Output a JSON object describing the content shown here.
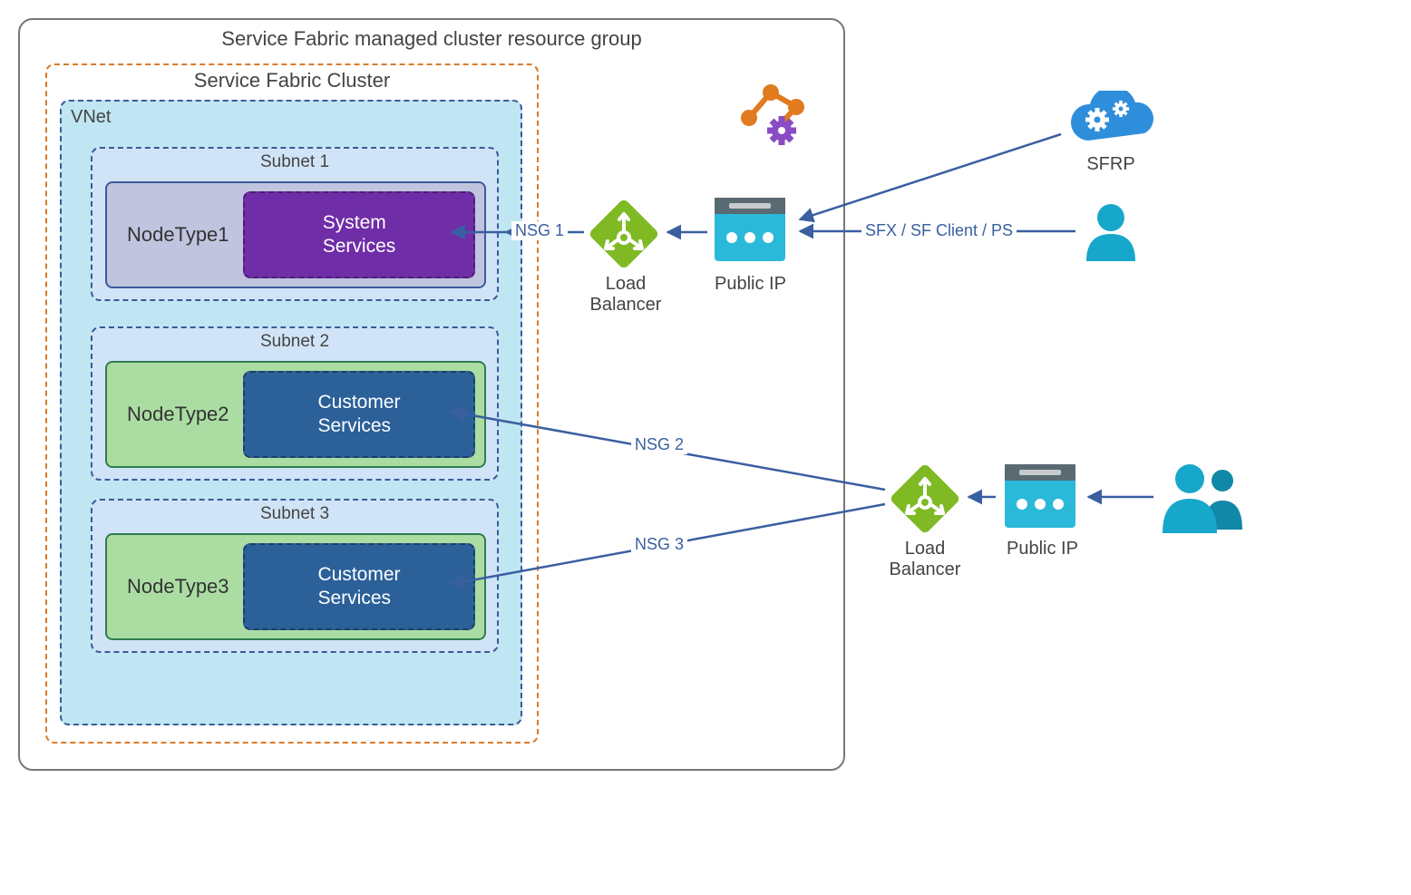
{
  "outer_title": "Service Fabric managed cluster resource group",
  "cluster_title": "Service Fabric Cluster",
  "vnet_label": "VNet",
  "subnets": {
    "s1": {
      "label": "Subnet 1",
      "nodetype": "NodeType1",
      "services": "System Services"
    },
    "s2": {
      "label": "Subnet 2",
      "nodetype": "NodeType2",
      "services": "Customer Services"
    },
    "s3": {
      "label": "Subnet 3",
      "nodetype": "NodeType3",
      "services": "Customer Services"
    }
  },
  "nsg": {
    "n1": "NSG 1",
    "n2": "NSG 2",
    "n3": "NSG 3"
  },
  "lb_label": "Load Balancer",
  "pip_label": "Public IP",
  "sfrp_label": "SFRP",
  "sfx_label": "SFX / SF Client / PS",
  "colors": {
    "arrow": "#3a5fa0",
    "lb_green": "#7fba25",
    "pip_cyan": "#2bb9d9",
    "pip_dark": "#5a6a72",
    "cloud": "#2f8edb",
    "user": "#17a7cb",
    "orange": "#e07b1f",
    "purple_gear": "#8b4bc4"
  }
}
